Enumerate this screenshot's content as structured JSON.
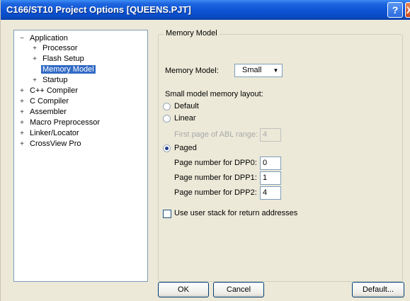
{
  "window": {
    "title": "C166/ST10 Project Options [QUEENS.PJT]",
    "help_label": "?",
    "close_label": "X"
  },
  "tree": [
    {
      "label": "Application",
      "expander": "−"
    },
    {
      "label": "Processor",
      "expander": "+"
    },
    {
      "label": "Flash Setup",
      "expander": "+"
    },
    {
      "label": "Memory Model",
      "expander": "",
      "selected": true
    },
    {
      "label": "Startup",
      "expander": "+"
    },
    {
      "label": "C++ Compiler",
      "expander": "+"
    },
    {
      "label": "C Compiler",
      "expander": "+"
    },
    {
      "label": "Assembler",
      "expander": "+"
    },
    {
      "label": "Macro Preprocessor",
      "expander": "+"
    },
    {
      "label": "Linker/Locator",
      "expander": "+"
    },
    {
      "label": "CrossView Pro",
      "expander": "+"
    }
  ],
  "panel": {
    "group_title": "Memory Model",
    "memory_model_label": "Memory Model:",
    "memory_model_value": "Small",
    "layout_label": "Small model memory layout:",
    "radio_default": "Default",
    "radio_linear": "Linear",
    "first_page_label": "First page of ABL range:",
    "first_page_value": "4",
    "radio_paged": "Paged",
    "dpp0_label": "Page number for DPP0:",
    "dpp0_value": "0",
    "dpp1_label": "Page number for DPP1:",
    "dpp1_value": "1",
    "dpp2_label": "Page number for DPP2:",
    "dpp2_value": "4",
    "user_stack_label": "Use user stack for return addresses",
    "selected_layout": "Paged"
  },
  "buttons": {
    "ok": "OK",
    "cancel": "Cancel",
    "default": "Default..."
  }
}
